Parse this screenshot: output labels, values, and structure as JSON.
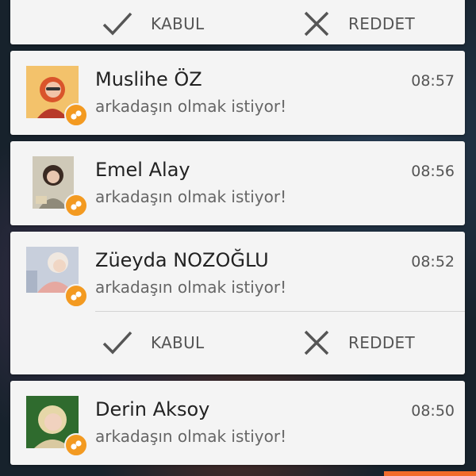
{
  "top_actions": {
    "accept_label": "KABUL",
    "reject_label": "REDDET"
  },
  "notifications": [
    {
      "name": "Muslihe ÖZ",
      "time": "08:57",
      "message": "arkadaşın olmak istiyor!",
      "avatar_colors": [
        "#f3c26b",
        "#d9542b",
        "#b83a2a"
      ]
    },
    {
      "name": "Emel Alay",
      "time": "08:56",
      "message": "arkadaşın olmak istiyor!",
      "avatar_colors": [
        "#cfc9b8",
        "#3a2a22",
        "#8f8a7a"
      ]
    },
    {
      "name": "Züeyda NOZOĞLU",
      "time": "08:52",
      "message": "arkadaşın olmak istiyor!",
      "avatar_colors": [
        "#c8cfdc",
        "#e6a8a0",
        "#f0d6c4"
      ],
      "actions": {
        "accept_label": "KABUL",
        "reject_label": "REDDET"
      }
    },
    {
      "name": "Derin Aksoy",
      "time": "08:50",
      "message": "arkadaşın olmak istiyor!",
      "avatar_colors": [
        "#2f6b2e",
        "#e6d7a8",
        "#f1d2bf"
      ]
    }
  ],
  "colors": {
    "card_bg": "#f4f4f4",
    "badge": "#f39a21",
    "accent_strip": "#f26b2a"
  }
}
